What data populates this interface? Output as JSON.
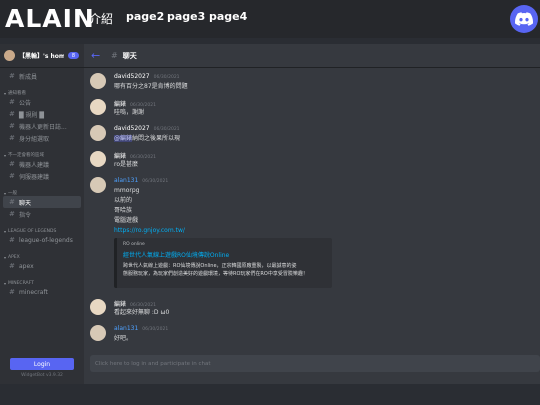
{
  "site": {
    "logo": "ALAIN",
    "nav": [
      "介紹",
      "page2",
      "page3",
      "page4"
    ]
  },
  "icons": {
    "discord": "discord-logo-icon",
    "back": "arrow-left-icon",
    "channel": "hash-icon"
  },
  "colors": {
    "accent": "#5865f2",
    "link": "#00aff4",
    "author_highlight": "#4ea1ff"
  },
  "guild": {
    "name": "【黑輪】's home",
    "badge": "8"
  },
  "sidebar": {
    "items": [
      {
        "kind": "channel",
        "label": "新成員"
      },
      {
        "kind": "category",
        "label": "通知看看"
      },
      {
        "kind": "channel",
        "label": "公告"
      },
      {
        "kind": "channel",
        "label": "█ 規則 █"
      },
      {
        "kind": "channel",
        "label": "機器人更新日誌..."
      },
      {
        "kind": "channel",
        "label": "身分組選取"
      },
      {
        "kind": "category",
        "label": "不一定會看的區域"
      },
      {
        "kind": "channel",
        "label": "機器人建議"
      },
      {
        "kind": "channel",
        "label": "伺服器建議"
      },
      {
        "kind": "category",
        "label": "一般"
      },
      {
        "kind": "channel",
        "label": "聊天",
        "active": true
      },
      {
        "kind": "channel",
        "label": "指令"
      },
      {
        "kind": "category",
        "label": "LEAGUE OF LEGENDS"
      },
      {
        "kind": "channel",
        "label": "league-of-legends"
      },
      {
        "kind": "category",
        "label": "APEX"
      },
      {
        "kind": "channel",
        "label": "apex"
      },
      {
        "kind": "category",
        "label": "MINECRAFT"
      },
      {
        "kind": "channel",
        "label": "minecraft"
      }
    ],
    "login_label": "Login",
    "footer": "WidgetBot v3.9.32"
  },
  "channel": {
    "name": "聊天"
  },
  "messages": [
    {
      "author": "david52027",
      "time": "06/30/2021",
      "lines": [
        "哪有百分之87是肯博的問題"
      ]
    },
    {
      "author": "編錶",
      "time": "06/30/2021",
      "lines": [
        "哇嗚，謝謝"
      ]
    },
    {
      "author": "david52027",
      "time": "06/30/2021",
      "mention": "@編錶",
      "lines": [
        "納悶之後果所以現"
      ]
    },
    {
      "author": "編錶",
      "time": "06/30/2021",
      "lines": [
        "ro是甚麼"
      ]
    },
    {
      "author": "alan131",
      "time": "06/30/2021",
      "lines": [
        "mmorpg",
        "以前的",
        "哥哈族",
        "電腦遊戲",
        "https://ro.gnjoy.com.tw/"
      ]
    },
    {
      "author": "編錶",
      "time": "06/30/2021",
      "lines": [
        "看起來好無聊 :D ω0"
      ]
    },
    {
      "author": "alan131",
      "time": "06/30/2021",
      "lines": [
        "好吧。"
      ]
    }
  ],
  "embed": {
    "provider": "RO online",
    "title": "經世代人氣線上遊戲RO仙境傳說Online",
    "description": [
      "跨世代人氣線上遊戲：RO仙境傳說Online，正宗韓國原廠重製，以最誠意的姿",
      "態服務玩家，為玩家們創造美好的遊戲環境，等待RO玩家們在RO中享受冒險樂趣！"
    ]
  },
  "composer": {
    "placeholder": "Click here to log in and participate in chat"
  }
}
